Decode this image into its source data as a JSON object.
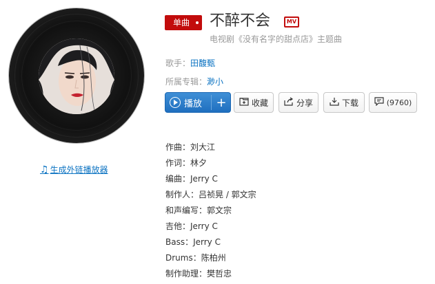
{
  "song": {
    "badge": "单曲",
    "title": "不醉不会",
    "mv_label": "MV",
    "subtitle": "电视剧《没有名字的甜点店》主题曲"
  },
  "meta": {
    "singer_label": "歌手：",
    "singer": "田馥甄",
    "album_label": "所属专辑：",
    "album": "渺小"
  },
  "actions": {
    "play": "播放",
    "add": "+",
    "collect": "收藏",
    "share": "分享",
    "download": "下载",
    "comments": "(9760)"
  },
  "player_link": "生成外链播放器",
  "credits": [
    "作曲：刘大江",
    "作词：林夕",
    "编曲：Jerry C",
    "制作人：吕祯晃 / 郭文宗",
    "和声编写：郭文宗",
    "吉他：Jerry C",
    "Bass：Jerry C",
    "Drums：陈柏州",
    "制作助理：樊哲忠"
  ],
  "colors": {
    "accent_red": "#c20c0c",
    "link_blue": "#0c73c2",
    "play_blue": "#2b7dd0"
  },
  "icons": [
    "music-note-icon",
    "play-circle-icon",
    "plus-icon",
    "folder-plus-icon",
    "share-icon",
    "download-icon",
    "comment-icon"
  ]
}
